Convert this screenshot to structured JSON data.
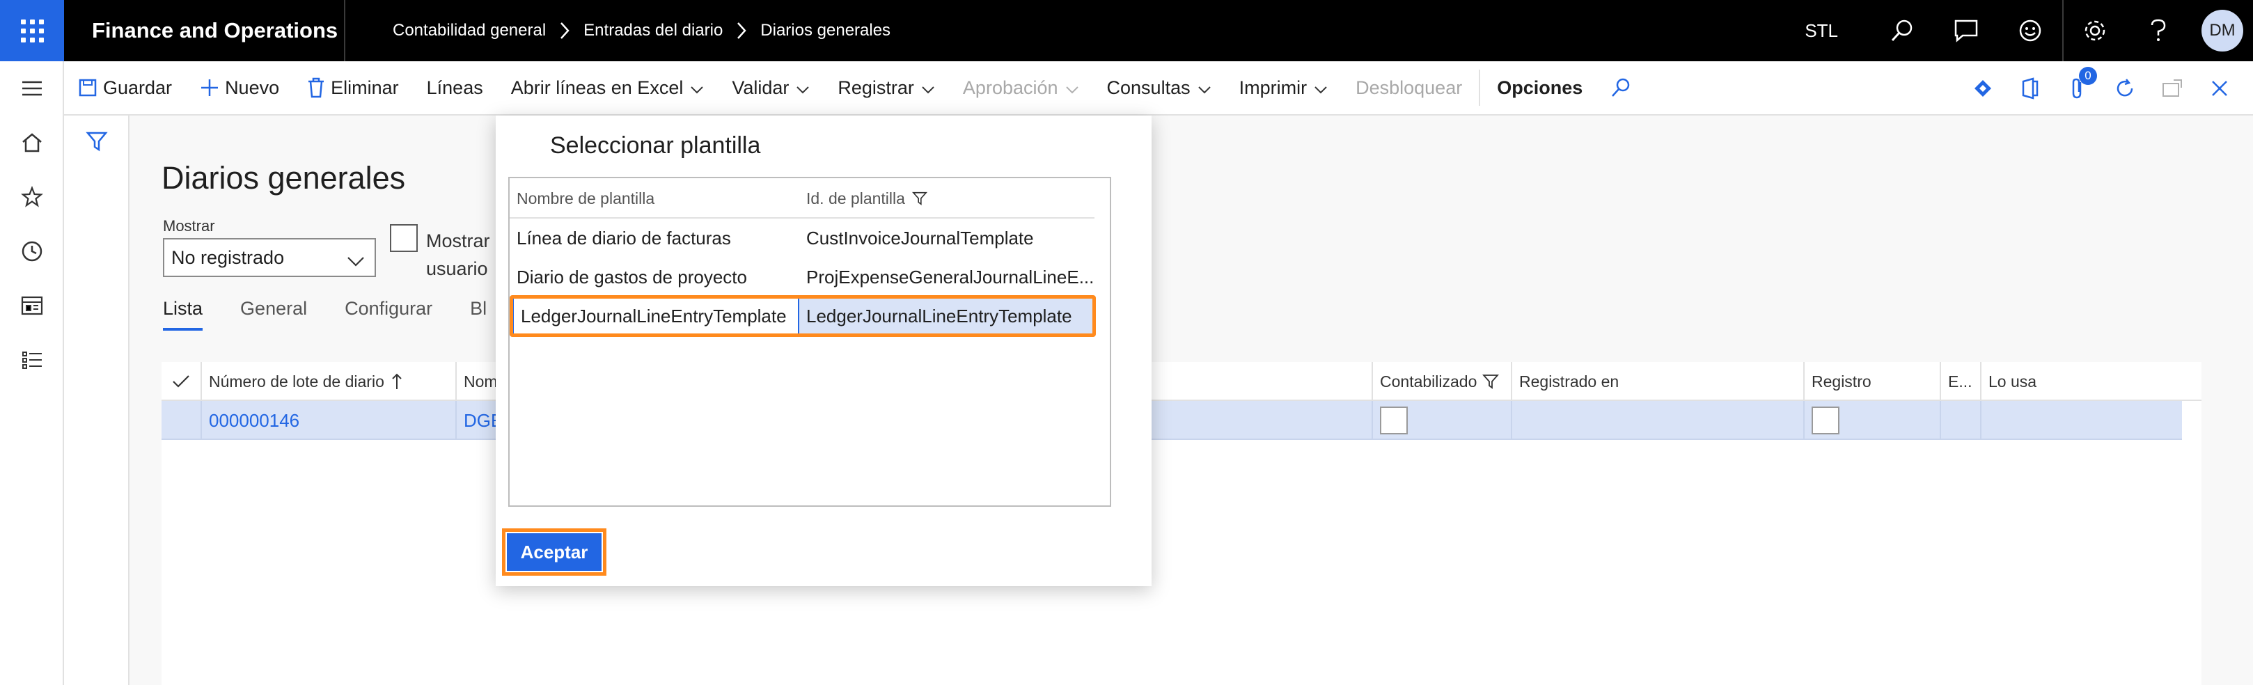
{
  "app": {
    "title": "Finance and Operations",
    "company": "STL",
    "avatar_initials": "DM"
  },
  "breadcrumb": [
    "Contabilidad general",
    "Entradas del diario",
    "Diarios generales"
  ],
  "toolbar": {
    "save": "Guardar",
    "new": "Nuevo",
    "delete": "Eliminar",
    "lines": "Líneas",
    "open_excel": "Abrir líneas en Excel",
    "validate": "Validar",
    "register": "Registrar",
    "approval": "Aprobación",
    "queries": "Consultas",
    "print": "Imprimir",
    "unlock": "Desbloquear",
    "options": "Opciones",
    "attachments_count": "0"
  },
  "page": {
    "title": "Diarios generales",
    "show_label": "Mostrar",
    "show_value": "No registrado",
    "user_checkbox_label": "Mostrar usuario",
    "tabs": [
      "Lista",
      "General",
      "Configurar",
      "Bl"
    ]
  },
  "grid": {
    "columns": {
      "batch": "Número de lote de diario",
      "name": "Nom",
      "posted": "Contabilizado",
      "registered_in": "Registrado en",
      "registry": "Registro",
      "e": "E...",
      "used_by": "Lo usa"
    },
    "rows": [
      {
        "batch": "000000146",
        "name": "DGE"
      }
    ]
  },
  "dialog": {
    "title": "Seleccionar plantilla",
    "col_name": "Nombre de plantilla",
    "col_id": "Id. de plantilla",
    "rows": [
      {
        "name": "Línea de diario de facturas",
        "id": "CustInvoiceJournalTemplate"
      },
      {
        "name": "Diario de gastos de proyecto",
        "id": "ProjExpenseGeneralJournalLineE..."
      },
      {
        "name": "LedgerJournalLineEntryTemplate",
        "id": "LedgerJournalLineEntryTemplate"
      }
    ],
    "accept": "Aceptar"
  },
  "colors": {
    "accent": "#2266e3",
    "highlight": "#ff8a1d",
    "topbar": "#000000",
    "selected_row": "#d9e3f7"
  }
}
